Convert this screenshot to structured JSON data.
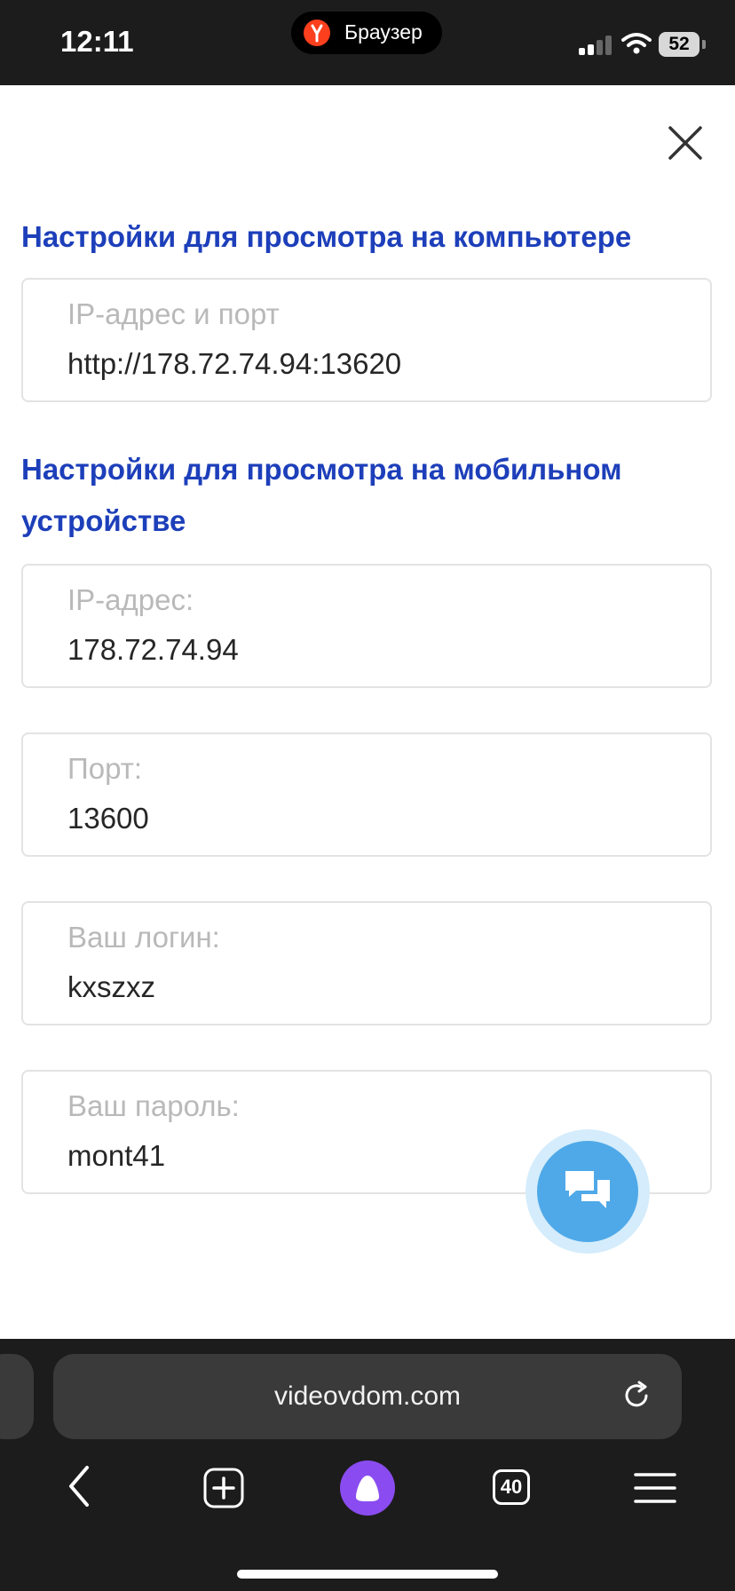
{
  "status_bar": {
    "time": "12:11",
    "app_name": "Браузер",
    "battery": "52"
  },
  "desktop_settings": {
    "title": "Настройки для просмотра на компьютере",
    "fields": [
      {
        "label": "IP-адрес и порт",
        "value": "http://178.72.74.94:13620"
      }
    ]
  },
  "mobile_settings": {
    "title": "Настройки для просмотра на мобильном устройстве",
    "fields": [
      {
        "label": "IP-адрес:",
        "value": "178.72.74.94"
      },
      {
        "label": "Порт:",
        "value": "13600"
      },
      {
        "label": "Ваш логин:",
        "value": "kxszxz"
      },
      {
        "label": "Ваш пароль:",
        "value": "mont41"
      }
    ]
  },
  "browser": {
    "url": "videovdom.com",
    "tabs_count": "40"
  },
  "colors": {
    "heading": "#1d3fba",
    "chat_button": "#4fa9e8",
    "alice": "#8a4cf0"
  }
}
